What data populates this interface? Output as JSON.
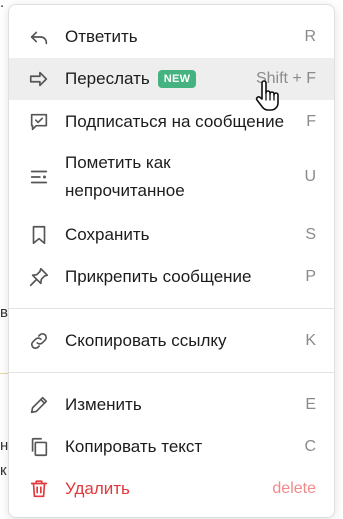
{
  "background": {
    "fragments": [
      "в",
      "на",
      "к"
    ]
  },
  "menu": {
    "items": [
      {
        "label": "Ответить",
        "shortcut": "R",
        "icon": "reply-icon"
      },
      {
        "label": "Переслать",
        "shortcut": "Shift + F",
        "icon": "forward-icon",
        "badge": "NEW",
        "state": "hover"
      },
      {
        "label": "Подписаться на сообщение",
        "shortcut": "F",
        "icon": "follow-message-icon"
      },
      {
        "label_line1": "Пометить как",
        "label_line2": "непрочитанное",
        "shortcut": "U",
        "icon": "mark-unread-icon"
      },
      {
        "label": "Сохранить",
        "shortcut": "S",
        "icon": "bookmark-icon"
      },
      {
        "label": "Прикрепить сообщение",
        "shortcut": "P",
        "icon": "pin-icon"
      },
      {
        "label": "Скопировать ссылку",
        "shortcut": "K",
        "icon": "link-icon"
      },
      {
        "label": "Изменить",
        "shortcut": "E",
        "icon": "pencil-icon"
      },
      {
        "label": "Копировать текст",
        "shortcut": "C",
        "icon": "copy-icon"
      },
      {
        "label": "Удалить",
        "shortcut": "delete",
        "icon": "trash-icon",
        "style": "danger"
      }
    ]
  },
  "colors": {
    "badge": "#44b37f",
    "danger": "#e0383c",
    "hover": "#eeeeee"
  }
}
